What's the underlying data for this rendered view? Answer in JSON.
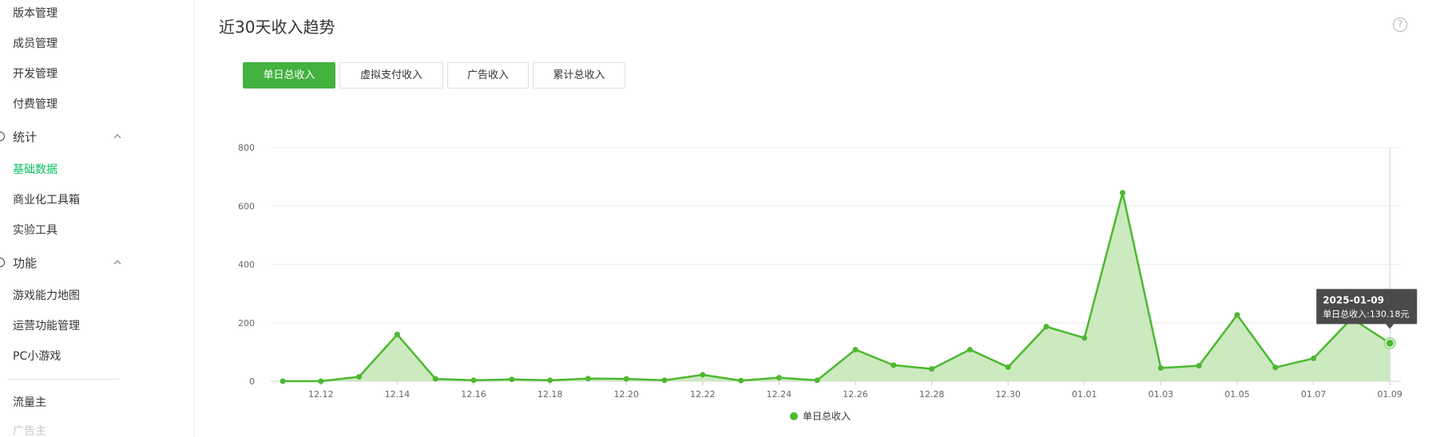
{
  "sidebar": {
    "items_top": [
      "版本管理",
      "成员管理",
      "开发管理",
      "付费管理"
    ],
    "group_stats": "统计",
    "stats_items": [
      "基础数据",
      "商业化工具箱",
      "实验工具"
    ],
    "group_features": "功能",
    "features_items": [
      "游戏能力地图",
      "运营功能管理",
      "PC小游戏"
    ],
    "items_bottom": [
      "流量主",
      "广告主"
    ],
    "active": "基础数据"
  },
  "panel": {
    "title": "近30天收入趋势",
    "help_glyph": "?",
    "tabs": [
      "单日总收入",
      "虚拟支付收入",
      "广告收入",
      "累计总收入"
    ],
    "active_tab": "单日总收入"
  },
  "colors": {
    "accent": "#07c160",
    "series": "#4cb82f",
    "area": "#c9e8bd",
    "tab_active": "#43b23f"
  },
  "chart_data": {
    "type": "area",
    "x": [
      "12.11",
      "12.12",
      "12.13",
      "12.14",
      "12.15",
      "12.16",
      "12.17",
      "12.18",
      "12.19",
      "12.20",
      "12.21",
      "12.22",
      "12.23",
      "12.24",
      "12.25",
      "12.26",
      "12.27",
      "12.28",
      "12.29",
      "12.30",
      "12.31",
      "01.01",
      "01.02",
      "01.03",
      "01.04",
      "01.05",
      "01.06",
      "01.07",
      "01.08",
      "01.09"
    ],
    "xticks": [
      "12.12",
      "12.14",
      "12.16",
      "12.18",
      "12.20",
      "12.22",
      "12.24",
      "12.26",
      "12.28",
      "12.30",
      "01.01",
      "01.03",
      "01.05",
      "01.07",
      "01.09"
    ],
    "yticks": [
      0,
      200,
      400,
      600,
      800
    ],
    "ylim": [
      0,
      800
    ],
    "series": [
      {
        "name": "单日总收入",
        "values": [
          0,
          0,
          15,
          160,
          8,
          3,
          6,
          3,
          9,
          8,
          3,
          22,
          2,
          12,
          3,
          108,
          55,
          42,
          108,
          48,
          187,
          148,
          645,
          45,
          53,
          227,
          47,
          78,
          215,
          130.18
        ]
      }
    ],
    "legend_position": "bottom-center",
    "grid": true,
    "tooltip": {
      "date": "2025-01-09",
      "label": "单日总收入:130.18元"
    }
  }
}
